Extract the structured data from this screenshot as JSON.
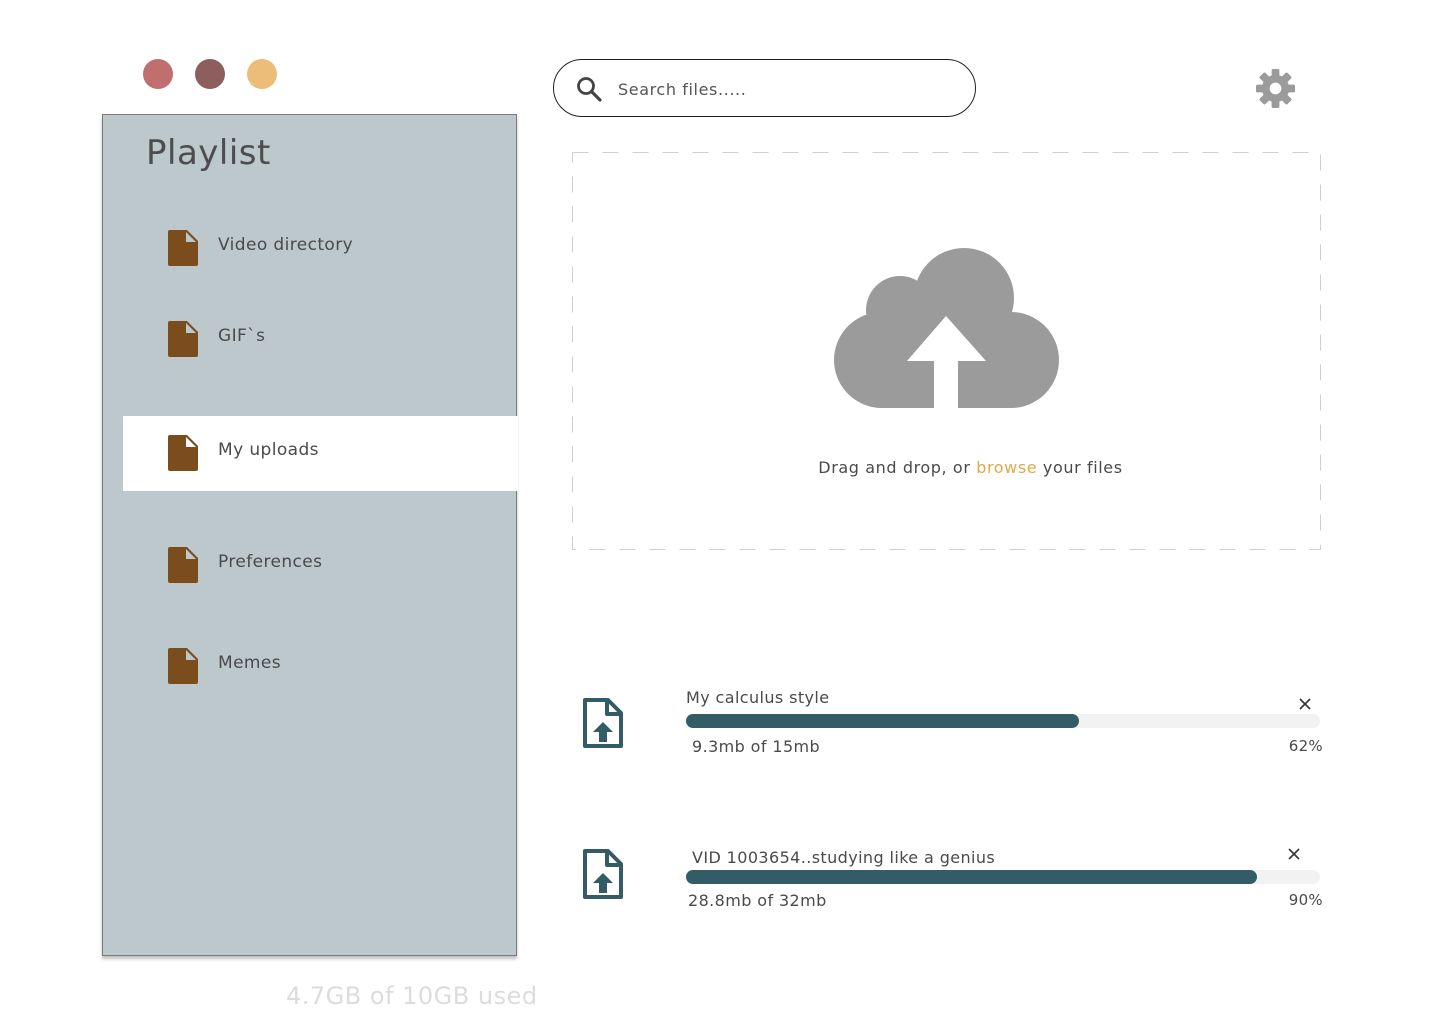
{
  "window_controls": {
    "colors": [
      "#c06e6e",
      "#8e5e5e",
      "#ebbd78"
    ]
  },
  "sidebar": {
    "background": "#bcc8cc",
    "title": "Playlist",
    "icon_color": "#7b4c1c",
    "items": [
      {
        "label": "Video directory",
        "icon": "file-icon",
        "active": false
      },
      {
        "label": "GIF`s",
        "icon": "file-icon",
        "active": false
      },
      {
        "label": "My uploads",
        "icon": "file-icon",
        "active": true
      },
      {
        "label": "Preferences",
        "icon": "file-icon",
        "active": false
      },
      {
        "label": "Memes",
        "icon": "file-icon",
        "active": false
      }
    ]
  },
  "storage": {
    "text": "4.7GB of 10GB used"
  },
  "search": {
    "placeholder": "Search files....."
  },
  "settings": {
    "icon": "gear-icon"
  },
  "dropzone": {
    "icon": "cloud-upload-icon",
    "text_before": "Drag and drop, or",
    "link": "browse",
    "text_after": "your files",
    "accent": "#e2a84b"
  },
  "uploads": {
    "bar_color": "#335c67",
    "items": [
      {
        "name": "My calculus style",
        "size": "9.3mb of 15mb",
        "progress": 0.62,
        "percent": "62%"
      },
      {
        "name": "VID 1003654..studying like a genius",
        "size": "28.8mb of 32mb",
        "progress": 0.9,
        "percent": "90%"
      }
    ]
  }
}
